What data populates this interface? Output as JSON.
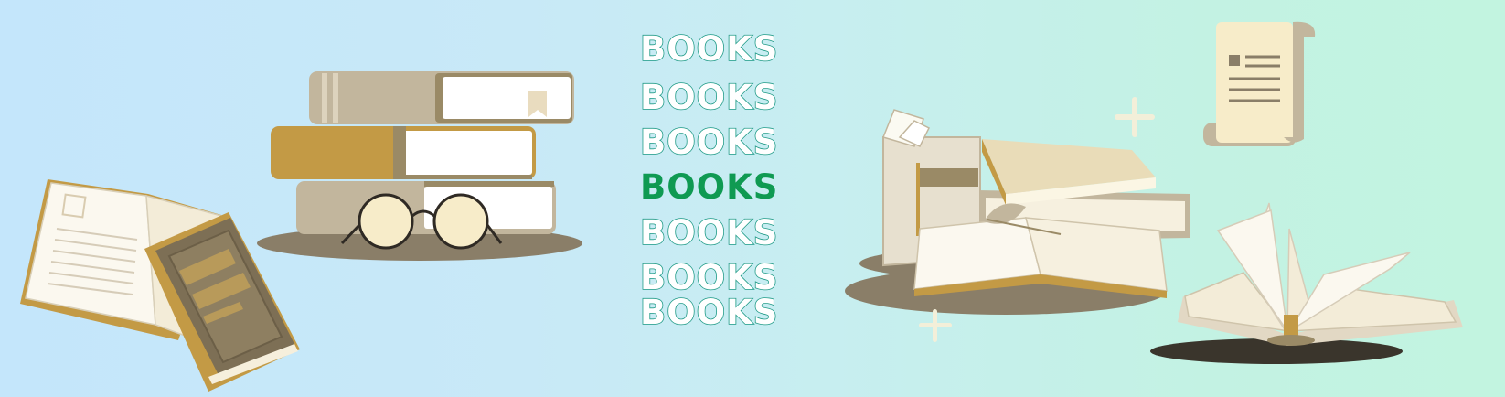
{
  "words": [
    "BOOKS",
    "BOOKS",
    "BOOKS",
    "BOOKS",
    "BOOKS",
    "BOOKS",
    "BOOKS"
  ],
  "highlighted_index": 3,
  "colors": {
    "outline_text": "#1e9a86",
    "highlight_text": "#0f9a52",
    "bg_left": "#c4e6fb",
    "bg_right": "#c2f4e0",
    "tan": "#c2b69d",
    "olive": "#9a8a66",
    "ochre": "#c39a45",
    "cream": "#f7f0d8",
    "shadow": "#8a7e68"
  },
  "icons": [
    "open-book-icon",
    "tablet-book-icon",
    "stacked-books-icon",
    "glasses-icon",
    "book-pile-icon",
    "scroll-icon",
    "open-book-fanned-icon",
    "sparkle-icon"
  ]
}
